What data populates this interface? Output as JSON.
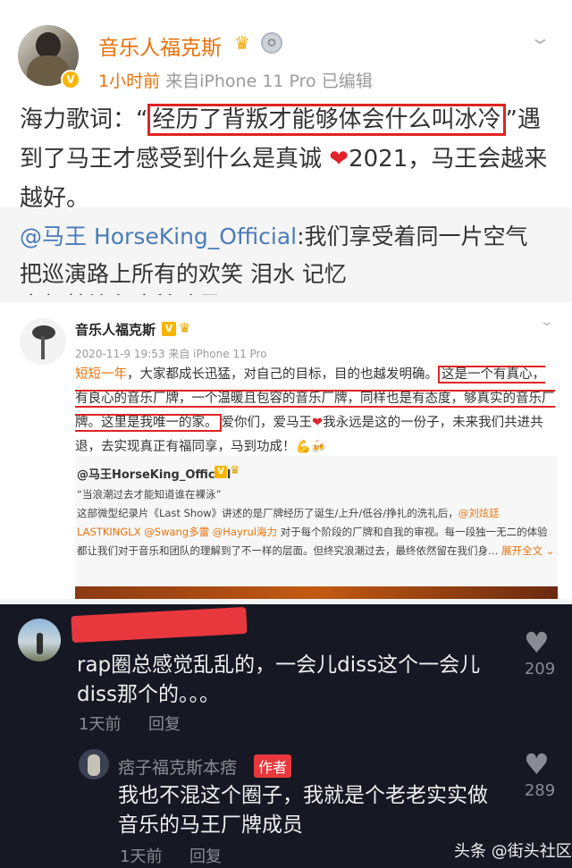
{
  "post1": {
    "author": "音乐人福克斯",
    "time": "1小时前",
    "source": "来自iPhone 11 Pro",
    "edited": "已编辑",
    "text_before": "海力歌词：“",
    "text_highlight": "经历了背叛才能够体会什么叫冰冷",
    "text_after": "”遇到了马王才感受到什么是真诚",
    "heart": "❤",
    "text_end": "2021，马王会越来越好。",
    "repost_mention": "@马王 HorseKing_Official",
    "repost_text": ":我们享受着同一片空气 把巡演路上所有的欢笑 泪水 记忆",
    "repost_cut": "全部献给在这首歌里"
  },
  "post2": {
    "author": "音乐人福克斯",
    "v_badge": "V",
    "meta": "2020-11-9 19:53 来自 iPhone 11 Pro",
    "text_orange": "短短一年",
    "text_1": "，大家都成长迅猛，对自己的目标，目的也越发明确。",
    "hl_1": "这是一个有真心，有良心的音乐厂牌，一个温暖且包容的音乐厂牌，同样也是有态度，够真实的音乐厂牌。这里是我唯一的家。",
    "text_2": "爱你们，爱马王",
    "heart": "❤",
    "text_3": "我永远是这的一份子，未来我们共进共退，去实现真正有福同享，马到功成！",
    "emojis": "💪🍻",
    "repost_author": "@马王HorseKing_Official",
    "repost_v": "V",
    "repost_quote": "“当浪潮过去才能知道谁在裸泳”",
    "repost_text_1": "这部微型纪录片《Last Show》讲述的是厂牌经历了诞生/上升/低谷/挣扎的洗礼后，",
    "repost_mention_1": "@刘炫廷LASTKINGLX",
    "repost_mention_2": "@Swang多雷",
    "repost_mention_3": "@Hayrul海力",
    "repost_text_2": "对于每个阶段的厂牌和自我的审视。每一段独一无二的体验都让我们对于音乐和团队的理解到了不一样的层面。但终究浪潮过去，最终依然留在我们身…",
    "expand": "展开全文",
    "expand_icon": "chevron-down"
  },
  "comments": [
    {
      "text": "rap圈总感觉乱乱的，一会儿diss这个一会儿diss那个的。。。",
      "time": "1天前",
      "reply": "回复",
      "likes": "209"
    },
    {
      "author": "痞子福克斯本痞",
      "badge": "作者",
      "text": "我也不混这个圈子，我就是个老老实实做音乐的马王厂牌成员",
      "time": "1天前",
      "reply": "回复",
      "likes": "289"
    }
  ],
  "watermark": "头条 @街头社区",
  "colors": {
    "weibo_orange": "#e8720c",
    "highlight_red": "#e02323",
    "mention_blue": "#4a7bb8",
    "dark_bg": "#161823"
  }
}
